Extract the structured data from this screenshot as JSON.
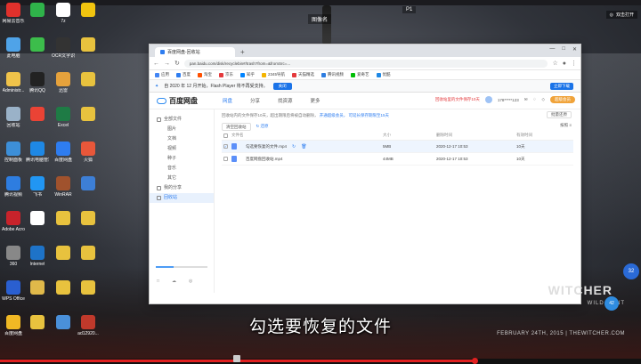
{
  "desktop": {
    "top_label": "图像名",
    "top_label2": "P1",
    "top_right_widget": "双击打开",
    "icons_col1": [
      {
        "label": "网易云音乐",
        "color": "#e0312c"
      },
      {
        "label": "此电脑",
        "color": "#4fa3e8"
      },
      {
        "label": "Administr...",
        "color": "#f0c34a"
      },
      {
        "label": "回收站",
        "color": "#9ab2c8"
      },
      {
        "label": "控制面板",
        "color": "#3d8fd8"
      },
      {
        "label": "腾讯视频",
        "color": "#2e7de0"
      },
      {
        "label": "Adobe Acrobat",
        "color": "#c8232b"
      },
      {
        "label": "360",
        "color": "#888"
      },
      {
        "label": "WPS Office",
        "color": "#2a5fd0"
      },
      {
        "label": "百度网盘",
        "color": "#f1b824"
      }
    ],
    "icons_col2": [
      {
        "label": "",
        "color": "#2fb34a"
      },
      {
        "label": "",
        "color": "#3cbd4b"
      },
      {
        "label": "腾讯QQ",
        "color": "#222"
      },
      {
        "label": "",
        "color": "#ea4335"
      },
      {
        "label": "腾讯电脑管家",
        "color": "#1e88e5"
      },
      {
        "label": "飞书",
        "color": "#2196f3"
      },
      {
        "label": "",
        "color": "#fff"
      },
      {
        "label": "Internet",
        "color": "#1e73c8"
      },
      {
        "label": "",
        "color": "#e0b94a"
      },
      {
        "label": "",
        "color": "#e8c23e"
      }
    ],
    "icons_col3": [
      {
        "label": "7z",
        "color": "#fff"
      },
      {
        "label": "OCR文字识别",
        "color": "#333"
      },
      {
        "label": "迅雷",
        "color": "#e6a23c"
      },
      {
        "label": "Excel",
        "color": "#1e7b45"
      },
      {
        "label": "百度网盘",
        "color": "#2e7df0"
      },
      {
        "label": "WinRAR",
        "color": "#a0522d"
      },
      {
        "label": "",
        "color": "#e8c23e"
      },
      {
        "label": "",
        "color": "#e8c23e"
      },
      {
        "label": "",
        "color": "#e8c23e"
      },
      {
        "label": "",
        "color": "#4a90d9"
      }
    ],
    "icons_col4": [
      {
        "label": "",
        "color": "#f1c40f"
      },
      {
        "label": "",
        "color": "#e8c23e"
      },
      {
        "label": "",
        "color": "#e8c23e"
      },
      {
        "label": "",
        "color": "#e8c23e"
      },
      {
        "label": "火狐",
        "color": "#e8573a"
      },
      {
        "label": "",
        "color": "#3d7fd6"
      },
      {
        "label": "",
        "color": "#e8c23e"
      },
      {
        "label": "",
        "color": "#e8c23e"
      },
      {
        "label": "",
        "color": "#e8c23e"
      },
      {
        "label": "ad12920...",
        "color": "#c0392b"
      }
    ],
    "subtitle": "勾选要恢复的文件",
    "witcher_title": "WITCHER",
    "witcher_sub": "WILD HUNT",
    "witcher_date": "FEBRUARY 24TH, 2015 | THEWITCHER.COM",
    "badge1": "32",
    "badge2": "42"
  },
  "browser": {
    "tab_title": "百度网盘-回收站",
    "new_tab": "+",
    "window_controls": [
      "—",
      "□",
      "✕"
    ],
    "url": "pan.baidu.com/disk/recyclebin#/trash?from=&fromSrc=...",
    "bookmarks": [
      {
        "label": "应用",
        "color": "#4285f4"
      },
      {
        "label": "百度",
        "color": "#2e7df0"
      },
      {
        "label": "淘宝",
        "color": "#ff5000"
      },
      {
        "label": "京东",
        "color": "#e4393c"
      },
      {
        "label": "知乎",
        "color": "#0084ff"
      },
      {
        "label": "2345导航",
        "color": "#f4b400"
      },
      {
        "label": "天猫精选",
        "color": "#e4393c"
      },
      {
        "label": "腾讯视频",
        "color": "#2e7de0"
      },
      {
        "label": "爱奇艺",
        "color": "#00be06"
      },
      {
        "label": "优酷",
        "color": "#1e88e5"
      }
    ],
    "info_text": "自 2020 年 12 月开始，Flash Player 将不再受支持。",
    "info_button": "关闭",
    "info_right": "立即下载"
  },
  "pan": {
    "logo": "百度网盘",
    "nav": [
      "网盘",
      "分享",
      "找资源",
      "更多"
    ],
    "nav_active": "网盘",
    "right_red": "回收站里的文件保存10天",
    "username": "178*****123",
    "vip": "超级会员",
    "sidebar": [
      {
        "label": "全部文件",
        "sub": false,
        "active": false
      },
      {
        "label": "图片",
        "sub": true,
        "active": false
      },
      {
        "label": "文档",
        "sub": true,
        "active": false
      },
      {
        "label": "视频",
        "sub": true,
        "active": false
      },
      {
        "label": "种子",
        "sub": true,
        "active": false
      },
      {
        "label": "音乐",
        "sub": true,
        "active": false
      },
      {
        "label": "其它",
        "sub": true,
        "active": false
      },
      {
        "label": "我的分享",
        "sub": false,
        "active": false
      },
      {
        "label": "回收站",
        "sub": false,
        "active": true
      }
    ],
    "storage_fill": 0.35,
    "side_bottom": [
      "□",
      "☁",
      "◎"
    ],
    "notice": "回收站内的文件保存10天，超出期限后将被自动删除，",
    "notice_link": "开通超级会员，",
    "notice_tail": "可延长保存期限至15天",
    "clean_btn": "清空回收站",
    "restore_btn": "↻ 还原",
    "right_tool": "批量还原",
    "right_tool2": "按照 ≡",
    "col_headers": [
      "文件名",
      "大小",
      "删除时间",
      "有效时间"
    ],
    "rows": [
      {
        "name": "勾选要恢复的文件.mp4",
        "size": "5MB",
        "time": "2020-12-17 10:53",
        "left": "10天",
        "selected": true
      },
      {
        "name": "百度网盘回收站.mp4",
        "size": "44MB",
        "time": "2020-12-17 10:53",
        "left": "10天",
        "selected": false
      }
    ]
  }
}
